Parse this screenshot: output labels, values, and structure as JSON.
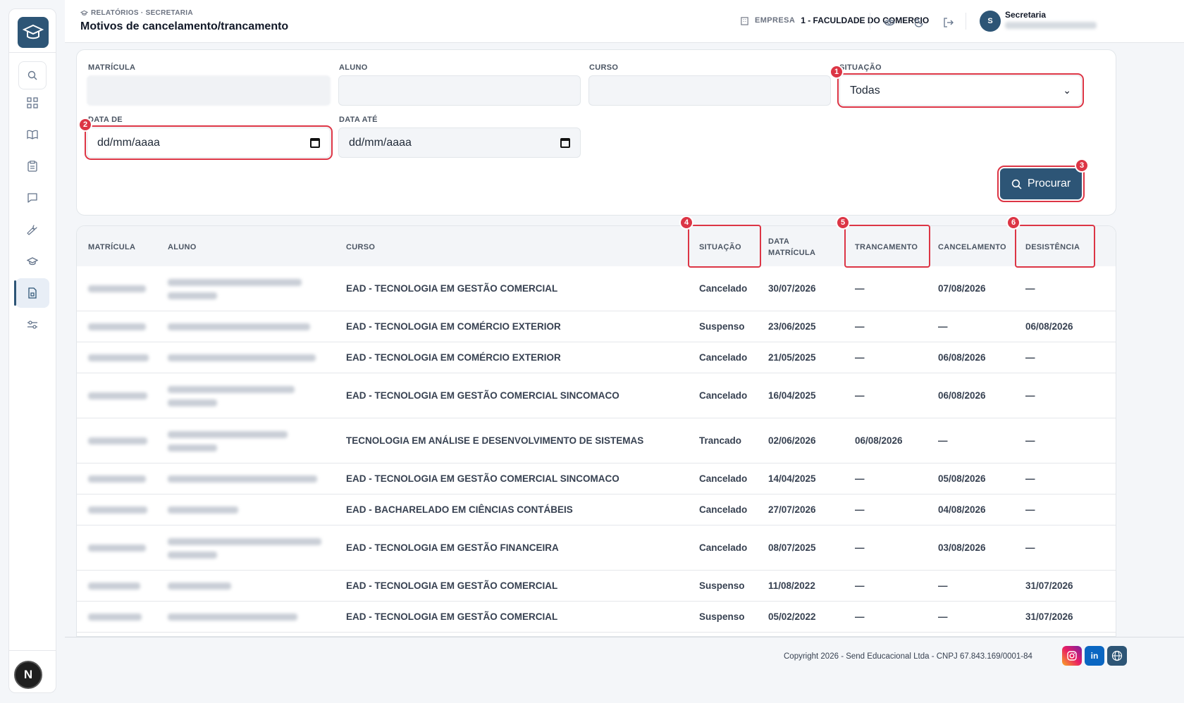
{
  "header": {
    "breadcrumb": "RELATÓRIOS · SECRETARIA",
    "title": "Motivos de cancelamento/trancamento",
    "empresa_label": "EMPRESA",
    "empresa_value": "1 - FACULDADE DO COMERCIO",
    "user_initial": "S",
    "user_name": "Secretaria"
  },
  "filters": {
    "matricula_label": "MATRÍCULA",
    "aluno_label": "ALUNO",
    "curso_label": "CURSO",
    "situacao_label": "SITUAÇÃO",
    "situacao_value": "Todas",
    "data_de_label": "DATA DE",
    "data_de_value": "dd/mm/aaaa",
    "data_ate_label": "DATA ATÉ",
    "data_ate_value": "dd/mm/aaaa",
    "search_button": "Procurar"
  },
  "badges": [
    "1",
    "2",
    "3",
    "4",
    "5",
    "6"
  ],
  "table": {
    "columns": {
      "matricula": "MATRÍCULA",
      "aluno": "ALUNO",
      "curso": "CURSO",
      "situacao": "SITUAÇÃO",
      "data_matricula": "DATA MATRÍCULA",
      "trancamento": "TRANCAMENTO",
      "cancelamento": "CANCELAMENTO",
      "desistencia": "DESISTÊNCIA"
    },
    "rows": [
      {
        "curso": "EAD - TECNOLOGIA EM GESTÃO COMERCIAL",
        "situacao": "Cancelado",
        "data_matricula": "30/07/2026",
        "trancamento": "—",
        "cancelamento": "07/08/2026",
        "desistencia": "—"
      },
      {
        "curso": "EAD - TECNOLOGIA EM COMÉRCIO EXTERIOR",
        "situacao": "Suspenso",
        "data_matricula": "23/06/2025",
        "trancamento": "—",
        "cancelamento": "—",
        "desistencia": "06/08/2026"
      },
      {
        "curso": "EAD - TECNOLOGIA EM COMÉRCIO EXTERIOR",
        "situacao": "Cancelado",
        "data_matricula": "21/05/2025",
        "trancamento": "—",
        "cancelamento": "06/08/2026",
        "desistencia": "—"
      },
      {
        "curso": "EAD - TECNOLOGIA EM GESTÃO COMERCIAL SINCOMACO",
        "situacao": "Cancelado",
        "data_matricula": "16/04/2025",
        "trancamento": "—",
        "cancelamento": "06/08/2026",
        "desistencia": "—"
      },
      {
        "curso": "TECNOLOGIA EM ANÁLISE E DESENVOLVIMENTO DE SISTEMAS",
        "situacao": "Trancado",
        "data_matricula": "02/06/2026",
        "trancamento": "06/08/2026",
        "cancelamento": "—",
        "desistencia": "—"
      },
      {
        "curso": "EAD - TECNOLOGIA EM GESTÃO COMERCIAL SINCOMACO",
        "situacao": "Cancelado",
        "data_matricula": "14/04/2025",
        "trancamento": "—",
        "cancelamento": "05/08/2026",
        "desistencia": "—"
      },
      {
        "curso": "EAD - BACHARELADO EM CIÊNCIAS CONTÁBEIS",
        "situacao": "Cancelado",
        "data_matricula": "27/07/2026",
        "trancamento": "—",
        "cancelamento": "04/08/2026",
        "desistencia": "—"
      },
      {
        "curso": "EAD - TECNOLOGIA EM GESTÃO FINANCEIRA",
        "situacao": "Cancelado",
        "data_matricula": "08/07/2025",
        "trancamento": "—",
        "cancelamento": "03/08/2026",
        "desistencia": "—"
      },
      {
        "curso": "EAD - TECNOLOGIA EM GESTÃO COMERCIAL",
        "situacao": "Suspenso",
        "data_matricula": "11/08/2022",
        "trancamento": "—",
        "cancelamento": "—",
        "desistencia": "31/07/2026"
      },
      {
        "curso": "EAD - TECNOLOGIA EM GESTÃO COMERCIAL",
        "situacao": "Suspenso",
        "data_matricula": "05/02/2022",
        "trancamento": "—",
        "cancelamento": "—",
        "desistencia": "31/07/2026"
      }
    ]
  },
  "footer": {
    "copyright": "Copyright 2026 - Send Educacional Ltda - CNPJ 67.843.169/0001-84",
    "linkedin": "in"
  },
  "sidebar": {
    "items": [
      "search-icon",
      "dashboard-icon",
      "book-icon",
      "clipboard-icon",
      "message-icon",
      "wrench-icon",
      "graduation-cap-icon",
      "report-icon",
      "settings-sliders-icon"
    ],
    "avatar_letter": "N"
  },
  "colors": {
    "brand": "#2d5576",
    "highlight": "#dc3545"
  }
}
